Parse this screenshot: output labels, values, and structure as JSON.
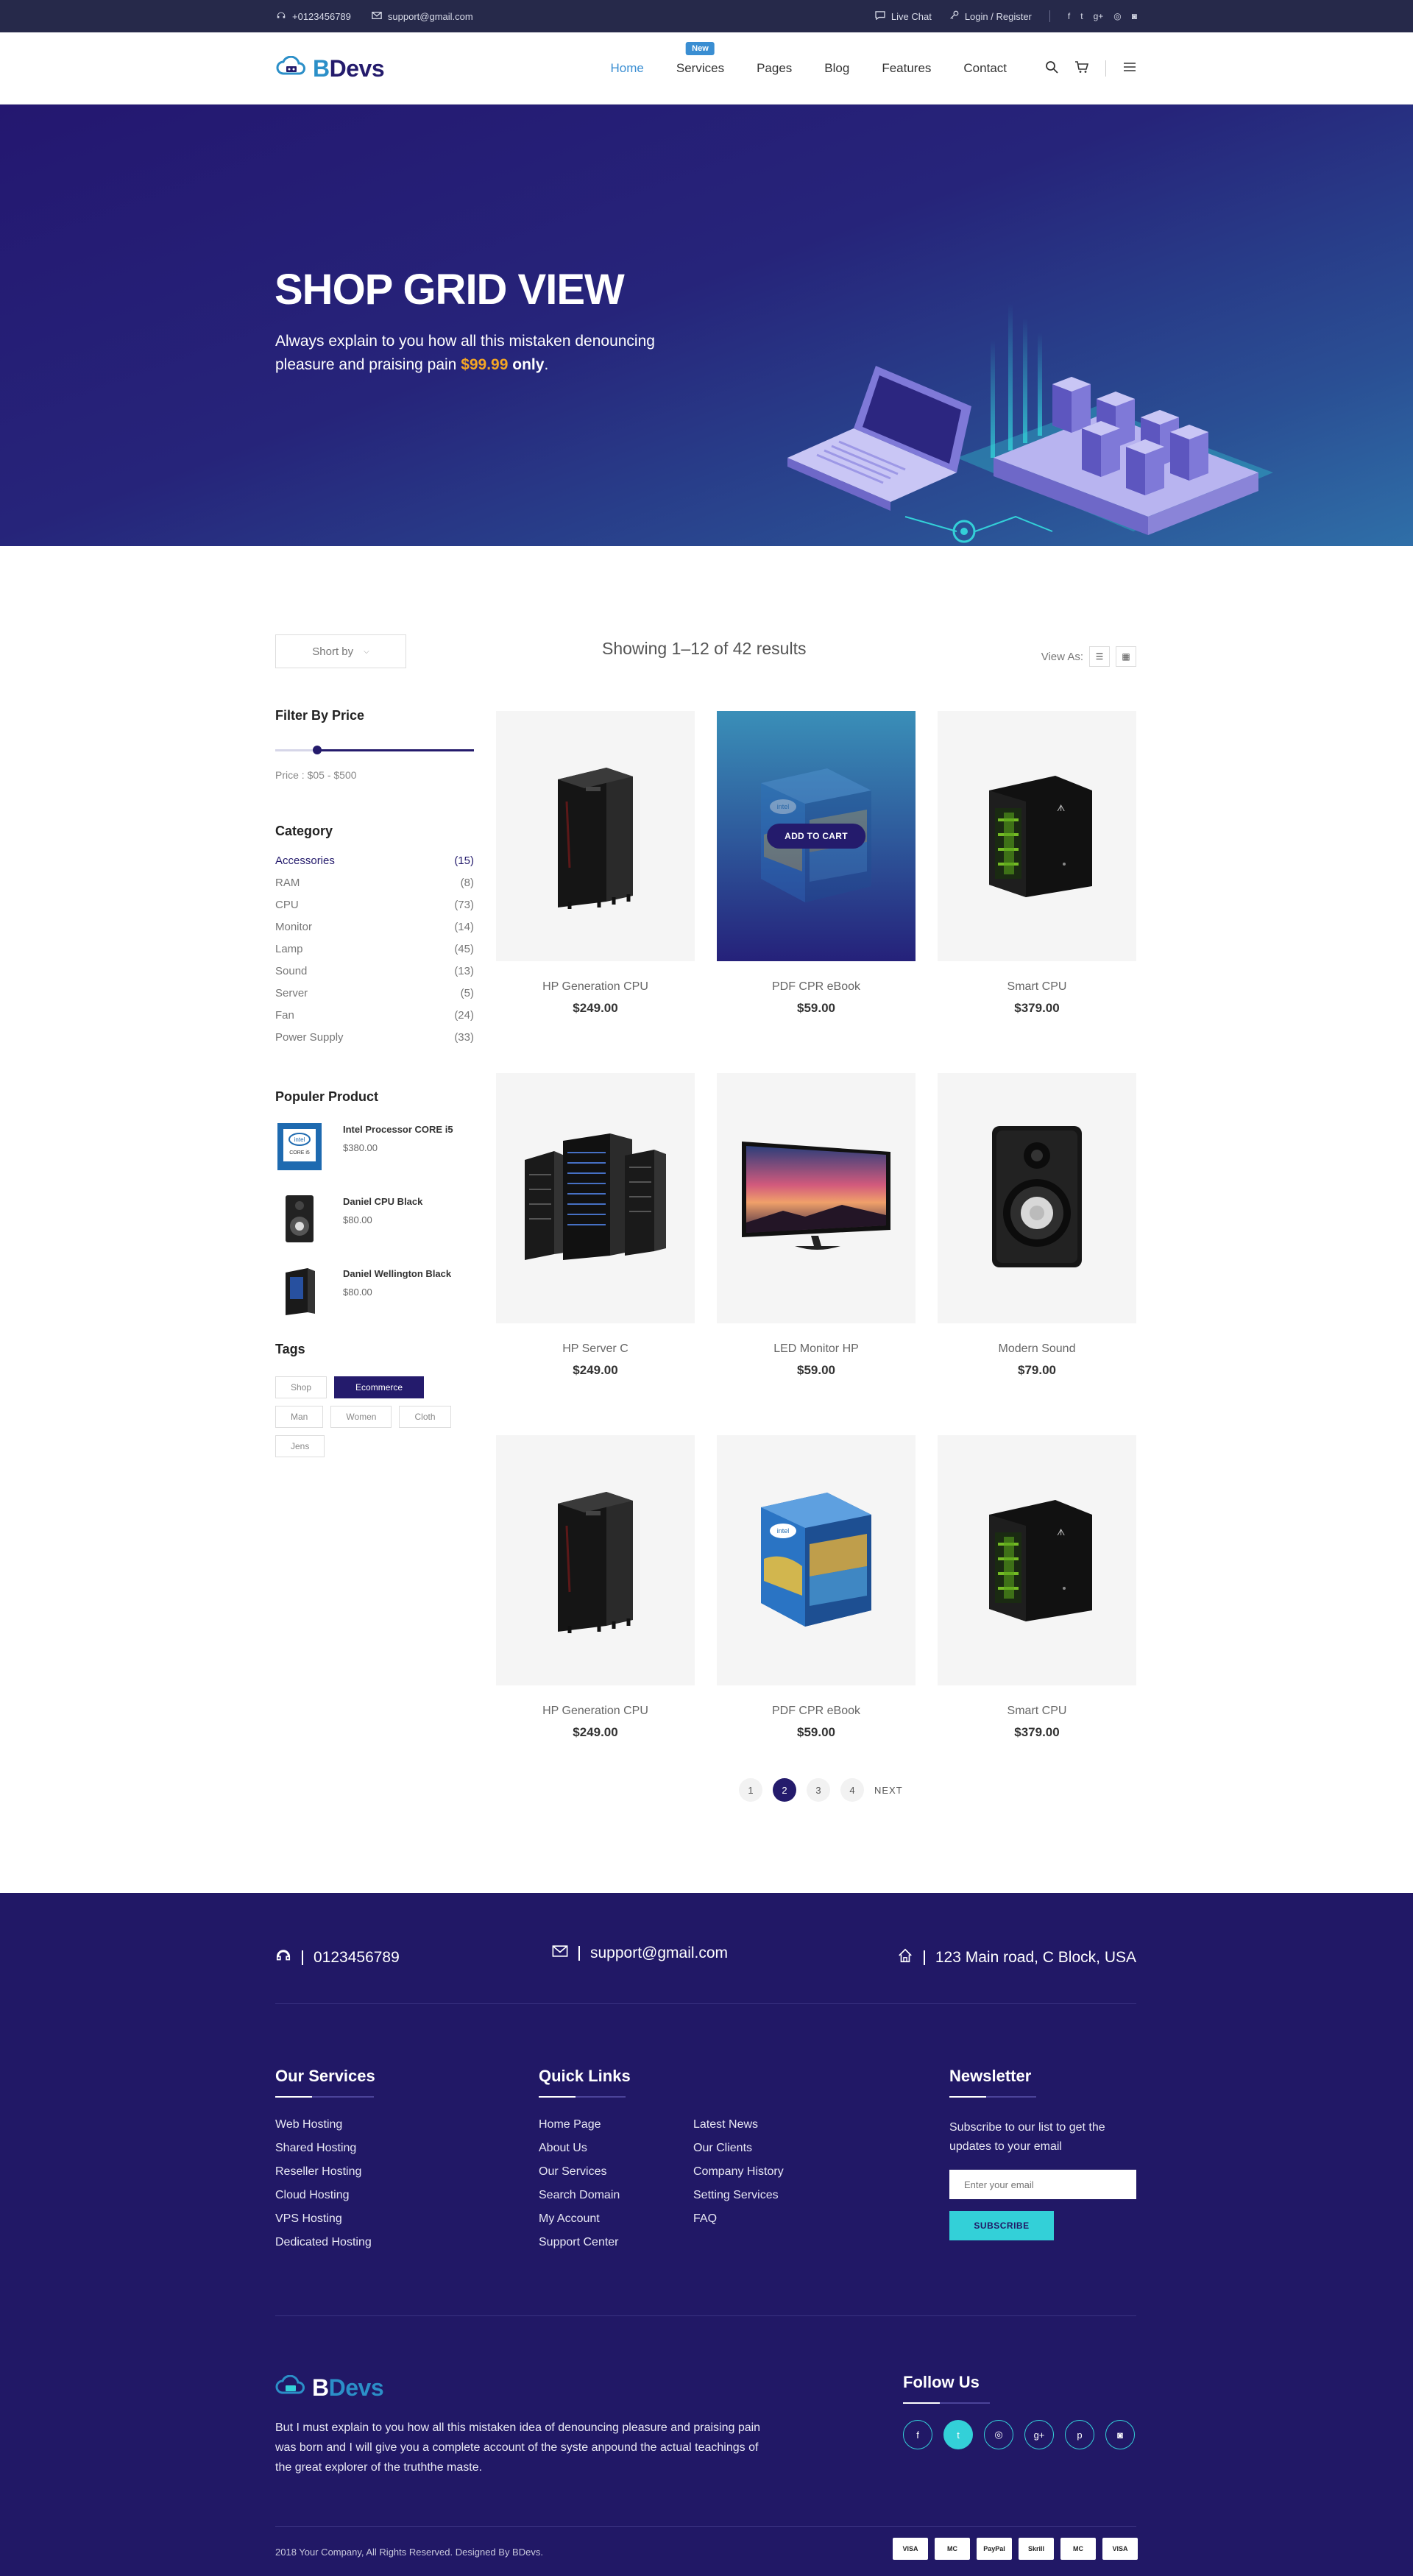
{
  "topbar": {
    "phone": "+0123456789",
    "email": "support@gmail.com",
    "live_chat": "Live Chat",
    "login": "Login / Register",
    "social": [
      "facebook-icon",
      "twitter-icon",
      "google-plus-icon",
      "dribbble-icon",
      "instagram-icon"
    ]
  },
  "header": {
    "logo_first": "B",
    "logo_rest": "Devs",
    "nav": [
      {
        "label": "Home",
        "active": true
      },
      {
        "label": "Services",
        "badge": "New"
      },
      {
        "label": "Pages"
      },
      {
        "label": "Blog"
      },
      {
        "label": "Features"
      },
      {
        "label": "Contact"
      }
    ]
  },
  "hero": {
    "title": "SHOP GRID VIEW",
    "text_before": "Always explain to you how all this mistaken denouncing pleasure and praising pain ",
    "price": "$99.99",
    "text_after": "only",
    "period": "."
  },
  "shop": {
    "sort_label": "Short by",
    "showing": "Showing 1–12 of 42 results",
    "view_as": "View As:"
  },
  "sidebar": {
    "filter_title": "Filter By Price",
    "price_label": "Price : $05 - $500",
    "price_range_fraction": [
      0.21,
      1.0
    ],
    "category_title": "Category",
    "categories": [
      {
        "name": "Accessories",
        "count": "(15)"
      },
      {
        "name": "RAM",
        "count": "(8)"
      },
      {
        "name": "CPU",
        "count": "(73)"
      },
      {
        "name": "Monitor",
        "count": "(14)"
      },
      {
        "name": "Lamp",
        "count": "(45)"
      },
      {
        "name": "Sound",
        "count": "(13)"
      },
      {
        "name": "Server",
        "count": "(5)"
      },
      {
        "name": "Fan",
        "count": "(24)"
      },
      {
        "name": "Power Supply",
        "count": "(33)"
      }
    ],
    "popular_title": "Populer Product",
    "popular": [
      {
        "name": "Intel Processor CORE i5",
        "price": "$380.00"
      },
      {
        "name": "Daniel CPU Black",
        "price": "$80.00"
      },
      {
        "name": "Daniel Wellington Black",
        "price": "$80.00"
      }
    ],
    "tags_title": "Tags",
    "tags": [
      "Shop",
      "Ecommerce",
      "Man",
      "Women",
      "Cloth",
      "Jens"
    ]
  },
  "products": [
    {
      "name": "HP Generation CPU",
      "price": "$249.00",
      "img": "tower-black"
    },
    {
      "name": "PDF CPR eBook",
      "price": "$59.00",
      "img": "box-blue",
      "hover": true
    },
    {
      "name": "Smart CPU",
      "price": "$379.00",
      "img": "tower-green"
    },
    {
      "name": "HP Server C",
      "price": "$249.00",
      "img": "server-rack"
    },
    {
      "name": "LED Monitor HP",
      "price": "$59.00",
      "img": "monitor"
    },
    {
      "name": "Modern Sound",
      "price": "$79.00",
      "img": "speaker"
    },
    {
      "name": "HP Generation CPU",
      "price": "$249.00",
      "img": "tower-black"
    },
    {
      "name": "PDF CPR eBook",
      "price": "$59.00",
      "img": "box-blue"
    },
    {
      "name": "Smart CPU",
      "price": "$379.00",
      "img": "tower-green"
    }
  ],
  "add_to_cart": "ADD TO CART",
  "pagination": {
    "pages": [
      "1",
      "2",
      "3",
      "4"
    ],
    "active": "2",
    "next": "NEXT"
  },
  "footer": {
    "phone": "0123456789",
    "email": "support@gmail.com",
    "address": "123 Main road, C Block, USA",
    "services_title": "Our Services",
    "services": [
      "Web Hosting",
      "Shared Hosting",
      "Reseller Hosting",
      "Cloud Hosting",
      "VPS Hosting",
      "Dedicated Hosting"
    ],
    "links_title": "Quick Links",
    "links_col1": [
      "Home Page",
      "About Us",
      "Our Services",
      "Search Domain",
      "My Account",
      "Support Center"
    ],
    "links_col2": [
      "Latest News",
      "Our Clients",
      "Company History",
      "Setting Services",
      "FAQ"
    ],
    "newsletter_title": "Newsletter",
    "newsletter_text": "Subscribe to our list to get the updates to your email",
    "newsletter_placeholder": "Enter your email",
    "subscribe": "SUBSCRIBE",
    "about": "But I must explain to you how all this mistaken idea of denouncing pleasure and praising pain was born and I will give you a complete account of the syste anpound the actual teachings of the great explorer of the truththe maste.",
    "follow_title": "Follow Us",
    "follow_icons": [
      "facebook-icon",
      "twitter-icon",
      "dribbble-icon",
      "google-plus-icon",
      "pinterest-icon",
      "instagram-icon"
    ],
    "copyright": "2018 Your Company, All Rights Reserved. Designed By BDevs.",
    "payments": [
      "VISA",
      "MC",
      "PayPal",
      "Skrill",
      "MC",
      "VISA"
    ]
  },
  "colors": {
    "primary": "#241b6c",
    "accent": "#33d0d8",
    "price_highlight": "#f5a623",
    "link_blue": "#3a8ed2"
  }
}
